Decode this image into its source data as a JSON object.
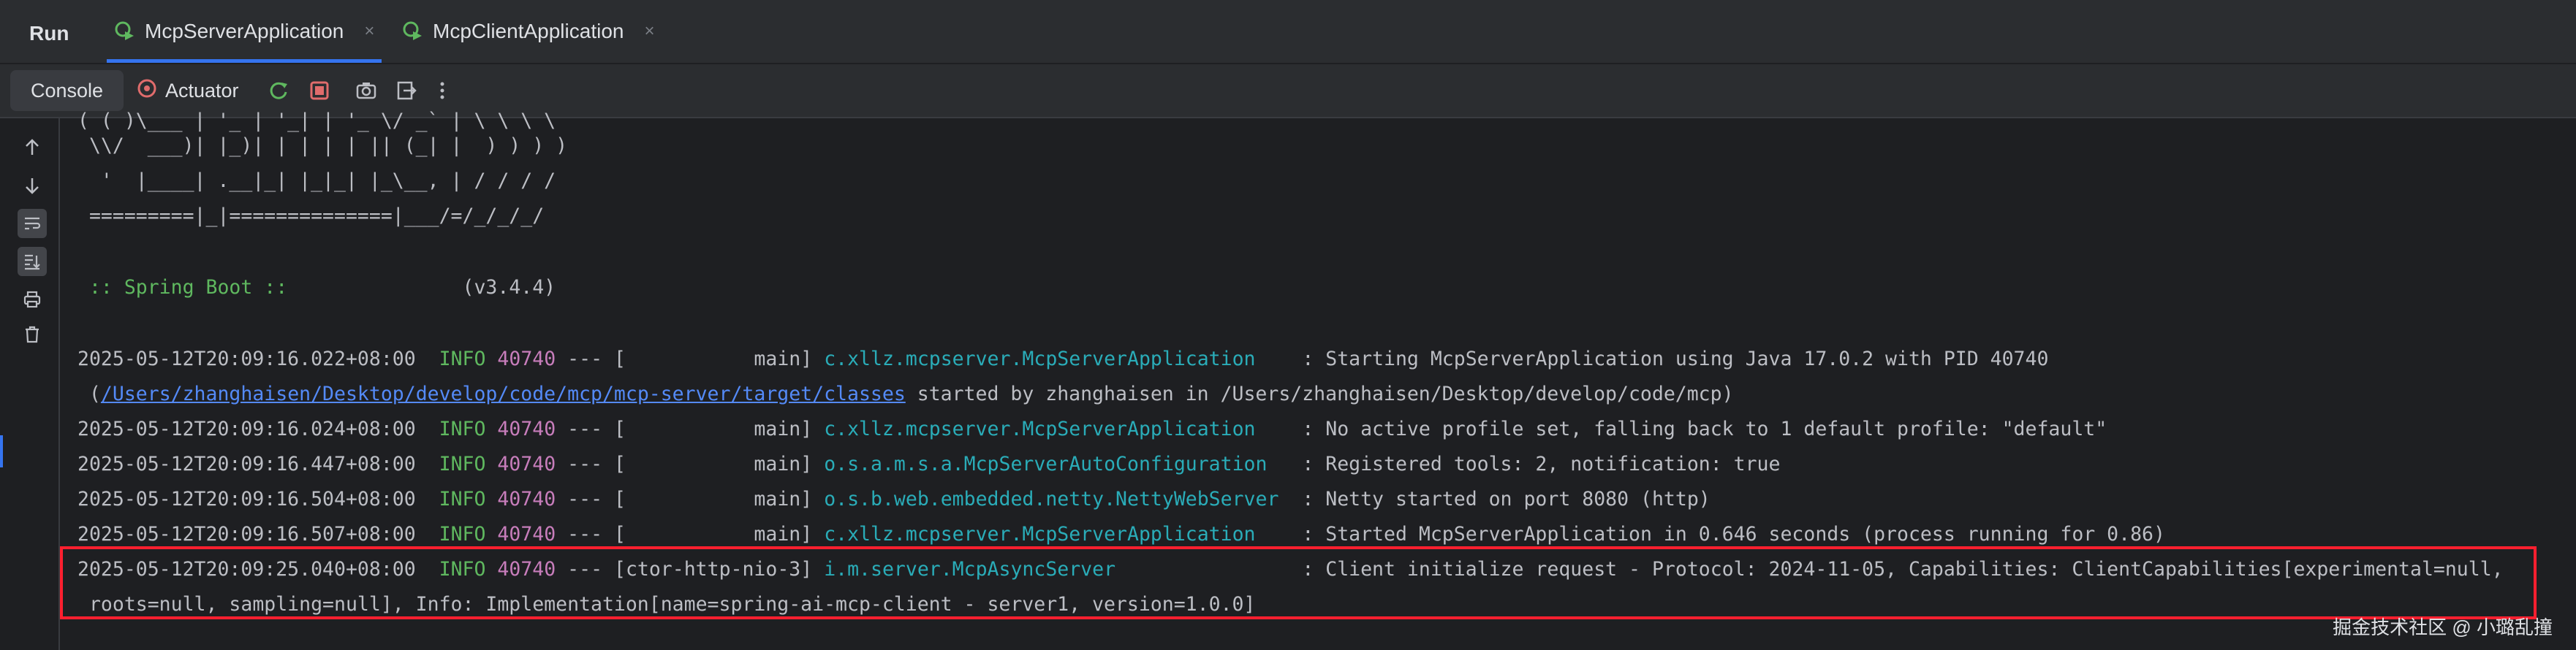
{
  "header": {
    "run_label": "Run",
    "tabs": [
      {
        "label": "McpServerApplication",
        "active": true
      },
      {
        "label": "McpClientApplication",
        "active": false
      }
    ],
    "close_glyph": "×"
  },
  "toolbar": {
    "console_label": "Console",
    "actuator_label": "Actuator",
    "icons": [
      "rerun-icon",
      "stop-icon",
      "camera-icon",
      "exit-icon",
      "more-icon"
    ]
  },
  "sidebar": {
    "icons": [
      "arrow-up-icon",
      "arrow-down-icon",
      "soft-wrap-icon",
      "scroll-to-end-icon",
      "print-icon",
      "trash-icon"
    ]
  },
  "console": {
    "banner": [
      "( ( )\\___ | '_ | '_| | '_ \\/ _` | \\ \\ \\ \\",
      " \\\\/  ___)| |_)| | | | | || (_| |  ) ) ) )",
      "  '  |____| .__|_| |_|_| |_\\__, | / / / /",
      " =========|_|==============|___/=/_/_/_/"
    ],
    "spring_label": " :: Spring Boot :: ",
    "spring_version": "              (v3.4.4)",
    "logs": [
      {
        "ts": "2025-05-12T20:09:16.022+08:00",
        "level": "INFO",
        "pid": "40740",
        "sep": "--- [",
        "thread": "           main]",
        "logger": "c.xllz.mcpserver.McpServerApplication   ",
        "msg": " : Starting McpServerApplication using Java 17.0.2 with PID 40740"
      },
      {
        "cont_pre": " (",
        "cont_link": "/Users/zhanghaisen/Desktop/develop/code/mcp/mcp-server/target/classes",
        "cont_post": " started by zhanghaisen in /Users/zhanghaisen/Desktop/develop/code/mcp)"
      },
      {
        "ts": "2025-05-12T20:09:16.024+08:00",
        "level": "INFO",
        "pid": "40740",
        "sep": "--- [",
        "thread": "           main]",
        "logger": "c.xllz.mcpserver.McpServerApplication   ",
        "msg": " : No active profile set, falling back to 1 default profile: \"default\""
      },
      {
        "ts": "2025-05-12T20:09:16.447+08:00",
        "level": "INFO",
        "pid": "40740",
        "sep": "--- [",
        "thread": "           main]",
        "logger": "o.s.a.m.s.a.McpServerAutoConfiguration  ",
        "msg": " : Registered tools: 2, notification: true"
      },
      {
        "ts": "2025-05-12T20:09:16.504+08:00",
        "level": "INFO",
        "pid": "40740",
        "sep": "--- [",
        "thread": "           main]",
        "logger": "o.s.b.web.embedded.netty.NettyWebServer ",
        "msg": " : Netty started on port 8080 (http)"
      },
      {
        "ts": "2025-05-12T20:09:16.507+08:00",
        "level": "INFO",
        "pid": "40740",
        "sep": "--- [",
        "thread": "           main]",
        "logger": "c.xllz.mcpserver.McpServerApplication   ",
        "msg": " : Started McpServerApplication in 0.646 seconds (process running for 0.86)"
      },
      {
        "ts": "2025-05-12T20:09:25.040+08:00",
        "level": "INFO",
        "pid": "40740",
        "sep": "--- [",
        "thread": "ctor-http-nio-3]",
        "logger": "i.m.server.McpAsyncServer               ",
        "msg": " : Client initialize request - Protocol: 2024-11-05, Capabilities: ClientCapabilities[experimental=null,"
      },
      {
        "cont_plain": " roots=null, sampling=null], Info: Implementation[name=spring-ai-mcp-client - server1, version=1.0.0]"
      }
    ]
  },
  "watermark": "掘金技术社区 @ 小璐乱撞",
  "colors": {
    "accent": "#3574f0",
    "highlight": "#ff1f2f",
    "info": "#5fb85f",
    "pid": "#c77dbb",
    "logger": "#2aacb8"
  }
}
